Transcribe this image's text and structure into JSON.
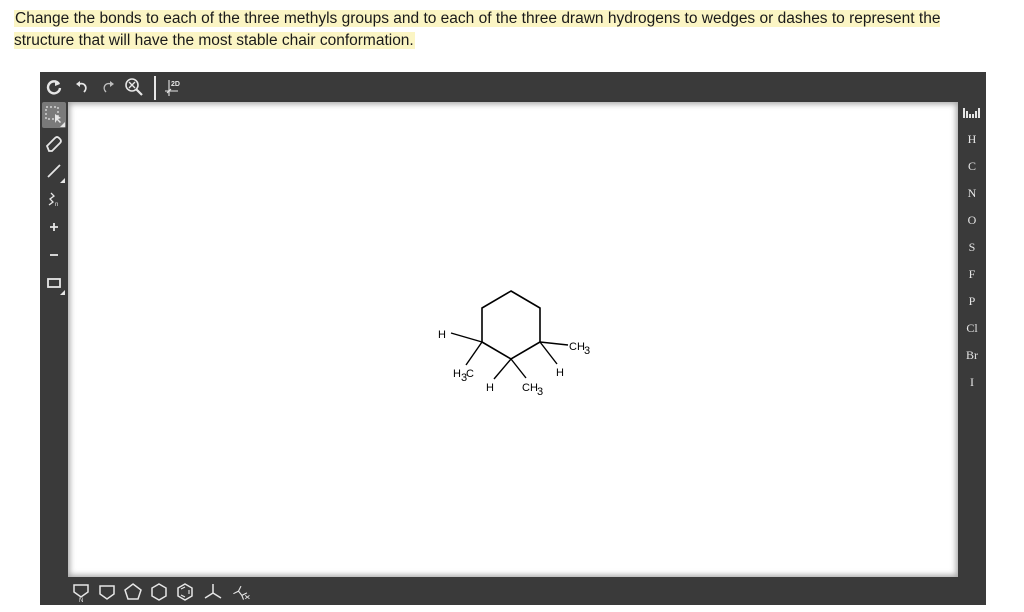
{
  "question": {
    "text": "Change the bonds to each of the three methyls groups and to each of the three drawn hydrogens to wedges or dashes to represent the structure that will have the most stable chair conformation."
  },
  "editor": {
    "top_toolbar": {
      "clean_2d_label": "2D"
    },
    "element_palette": [
      "H",
      "C",
      "N",
      "O",
      "S",
      "F",
      "P",
      "Cl",
      "Br",
      "I"
    ],
    "molecule_labels": {
      "h_left": "H",
      "ch3_left_main": "H",
      "ch3_left_sub": "3",
      "ch3_left_c": "C",
      "h_bottom_left": "H",
      "ch3_bottom_main": "CH",
      "ch3_bottom_sub": "3",
      "h_bottom_right": "H",
      "ch3_right_main": "CH",
      "ch3_right_sub": "3"
    }
  }
}
